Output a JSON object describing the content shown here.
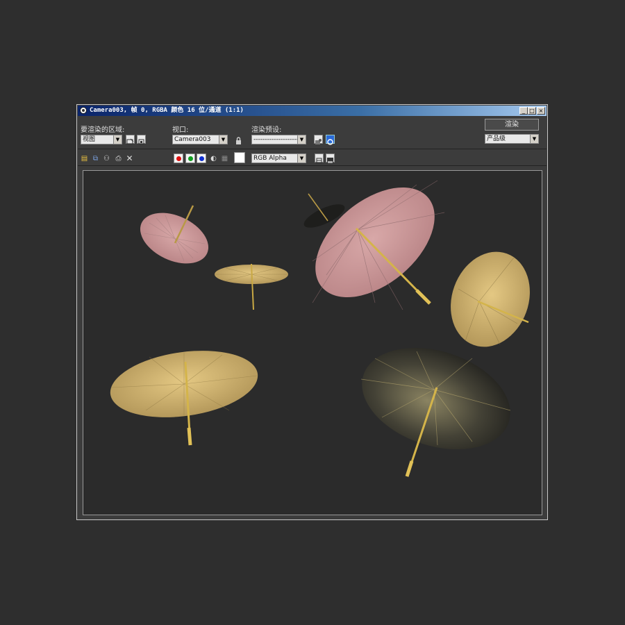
{
  "window": {
    "title": "Camera003, 帧 0, RGBA 颜色 16 位/通道 (1:1)",
    "controls": {
      "minimize": "_",
      "maximize": "□",
      "close": "×"
    }
  },
  "area": {
    "label": "要渲染的区域:",
    "value": "视图"
  },
  "viewport": {
    "label": "视口:",
    "value": "Camera003"
  },
  "preset": {
    "label": "渲染预设:",
    "value": "-------------------------"
  },
  "render": {
    "button": "渲染",
    "quality": "产品级"
  },
  "channel": {
    "value": "RGB Alpha"
  },
  "icons": [
    "save-icon",
    "copy-icon",
    "clone-icon",
    "print-icon",
    "clear-icon",
    "red-channel-icon",
    "green-channel-icon",
    "blue-channel-icon",
    "alpha-icon",
    "mono-icon",
    "color-swatch",
    "lock-icon",
    "setup-icon",
    "env-icon"
  ],
  "colors": {
    "accent": "#0a246a",
    "umbrella_pink": "#c9959a",
    "umbrella_gold": "#bca15e",
    "handle": "#d4b44a"
  }
}
